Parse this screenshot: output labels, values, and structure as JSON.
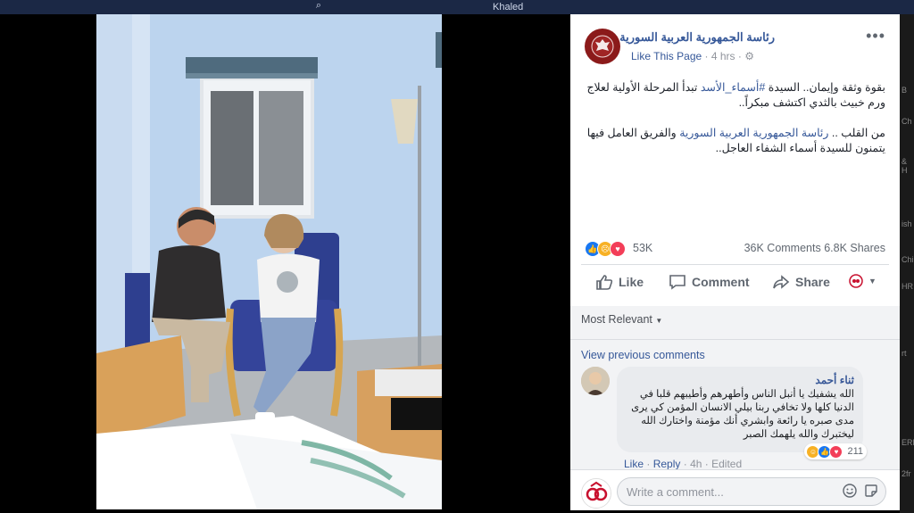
{
  "topbar": {
    "user_name": "Khaled"
  },
  "right_strip": [
    "B",
    "Ch",
    "& H",
    "ish",
    "Chi",
    "HR",
    "rt",
    "ERR",
    "2fr"
  ],
  "post": {
    "page_name": "رئاسة الجمهورية العربية السورية",
    "like_page": "Like This Page",
    "time": "4 hrs",
    "paragraph1_a": "بقوة وثقة وإيمان.. السيدة ",
    "paragraph1_tag": "#أسماء_الأسد",
    "paragraph1_b": " تبدأ المرحلة الأولية لعلاج ورم خبيث بالثدي اكتشف مبكراً..",
    "paragraph2_a": "من القلب .. ",
    "paragraph2_tag": "رئاسة الجمهورية العربية السورية",
    "paragraph2_b": " والفريق العامل فيها يتمنون للسيدة أسماء الشفاء العاجل..",
    "reaction_count": "53K",
    "comments_shares": "36K Comments  6.8K Shares"
  },
  "actions": {
    "like": "Like",
    "comment": "Comment",
    "share": "Share"
  },
  "comments": {
    "sort_label": "Most Relevant",
    "view_previous": "View previous comments",
    "items": [
      {
        "author": "ثناء أحمد",
        "text": "الله يشفيك يا أنبل الناس وأطهرهم وأطيبهم قلبا في الدنيا كلها ولا تخافي ربنا بيلي الانسان المؤمن كي يرى مدى صبره يا رائعة وابشري أنك مؤمنة واختارك الله ليختبرك والله يلهمك الصبر",
        "reaction_count": "211",
        "like": "Like",
        "reply": "Reply",
        "time": "4h",
        "edited": "Edited"
      }
    ],
    "write_placeholder": "Write a comment..."
  },
  "colors": {
    "link": "#365899",
    "brand": "#3b5998",
    "logo": "#8b1a1a"
  }
}
